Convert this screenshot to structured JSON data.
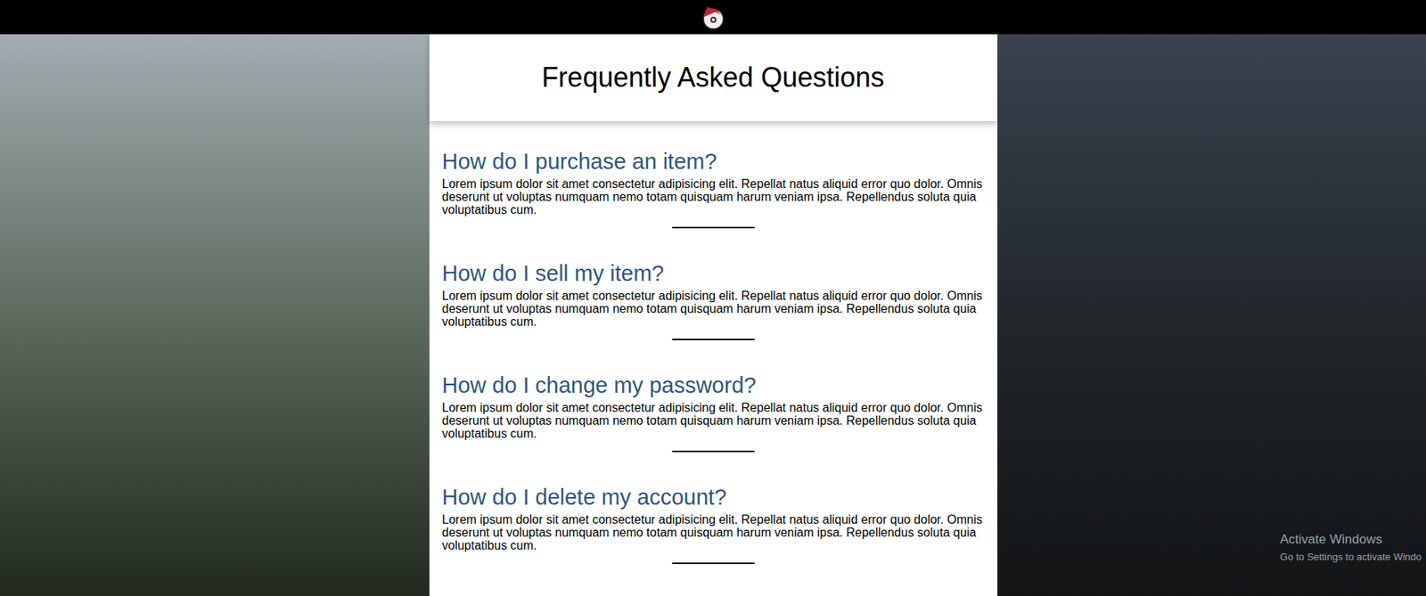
{
  "page": {
    "title": "Frequently Asked Questions"
  },
  "faqs": [
    {
      "question": "How do I purchase an item?",
      "answer": "Lorem ipsum dolor sit amet consectetur adipisicing elit. Repellat natus aliquid error quo dolor. Omnis deserunt ut voluptas numquam nemo totam quisquam harum veniam ipsa. Repellendus soluta quia voluptatibus cum."
    },
    {
      "question": "How do I sell my item?",
      "answer": "Lorem ipsum dolor sit amet consectetur adipisicing elit. Repellat natus aliquid error quo dolor. Omnis deserunt ut voluptas numquam nemo totam quisquam harum veniam ipsa. Repellendus soluta quia voluptatibus cum."
    },
    {
      "question": "How do I change my password?",
      "answer": "Lorem ipsum dolor sit amet consectetur adipisicing elit. Repellat natus aliquid error quo dolor. Omnis deserunt ut voluptas numquam nemo totam quisquam harum veniam ipsa. Repellendus soluta quia voluptatibus cum."
    },
    {
      "question": "How do I delete my account?",
      "answer": "Lorem ipsum dolor sit amet consectetur adipisicing elit. Repellat natus aliquid error quo dolor. Omnis deserunt ut voluptas numquam nemo totam quisquam harum veniam ipsa. Repellendus soluta quia voluptatibus cum."
    }
  ],
  "watermark": {
    "title": "Activate Windows",
    "subtitle": "Go to Settings to activate Windo"
  }
}
